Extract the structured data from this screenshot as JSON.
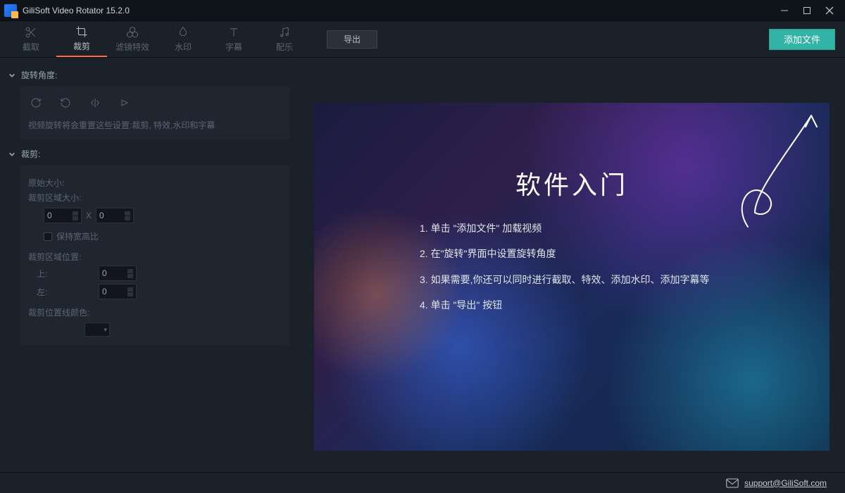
{
  "app": {
    "title": "GiliSoft Video Rotator 15.2.0"
  },
  "toolbar": {
    "tabs": [
      {
        "label": "截取"
      },
      {
        "label": "裁剪"
      },
      {
        "label": "滤镜特效"
      },
      {
        "label": "水印"
      },
      {
        "label": "字幕"
      },
      {
        "label": "配乐"
      }
    ],
    "export_label": "导出",
    "add_file_label": "添加文件"
  },
  "panel": {
    "rotation": {
      "header": "旋转角度:",
      "hint": "视频旋转将会重置这些设置:裁剪, 特效,水印和字幕"
    },
    "crop": {
      "header": "裁剪:",
      "orig_size_label": "原始大小:",
      "crop_size_label": "裁剪区域大小:",
      "w": "0",
      "h": "0",
      "keep_ratio_label": "保持宽高比",
      "crop_pos_label": "裁剪区域位置:",
      "top_label": "上:",
      "top_val": "0",
      "left_label": "左:",
      "left_val": "0",
      "line_color_label": "裁剪位置线颜色:"
    }
  },
  "preview": {
    "title": "软件入门",
    "steps": [
      "1. 单击 \"添加文件\" 加载视频",
      "2. 在\"旋转\"界面中设置旋转角度",
      "3. 如果需要,你还可以同时进行截取、特效、添加水印、添加字幕等",
      "4. 单击 \"导出\" 按钮"
    ]
  },
  "footer": {
    "support": "support@GiliSoft.com"
  }
}
